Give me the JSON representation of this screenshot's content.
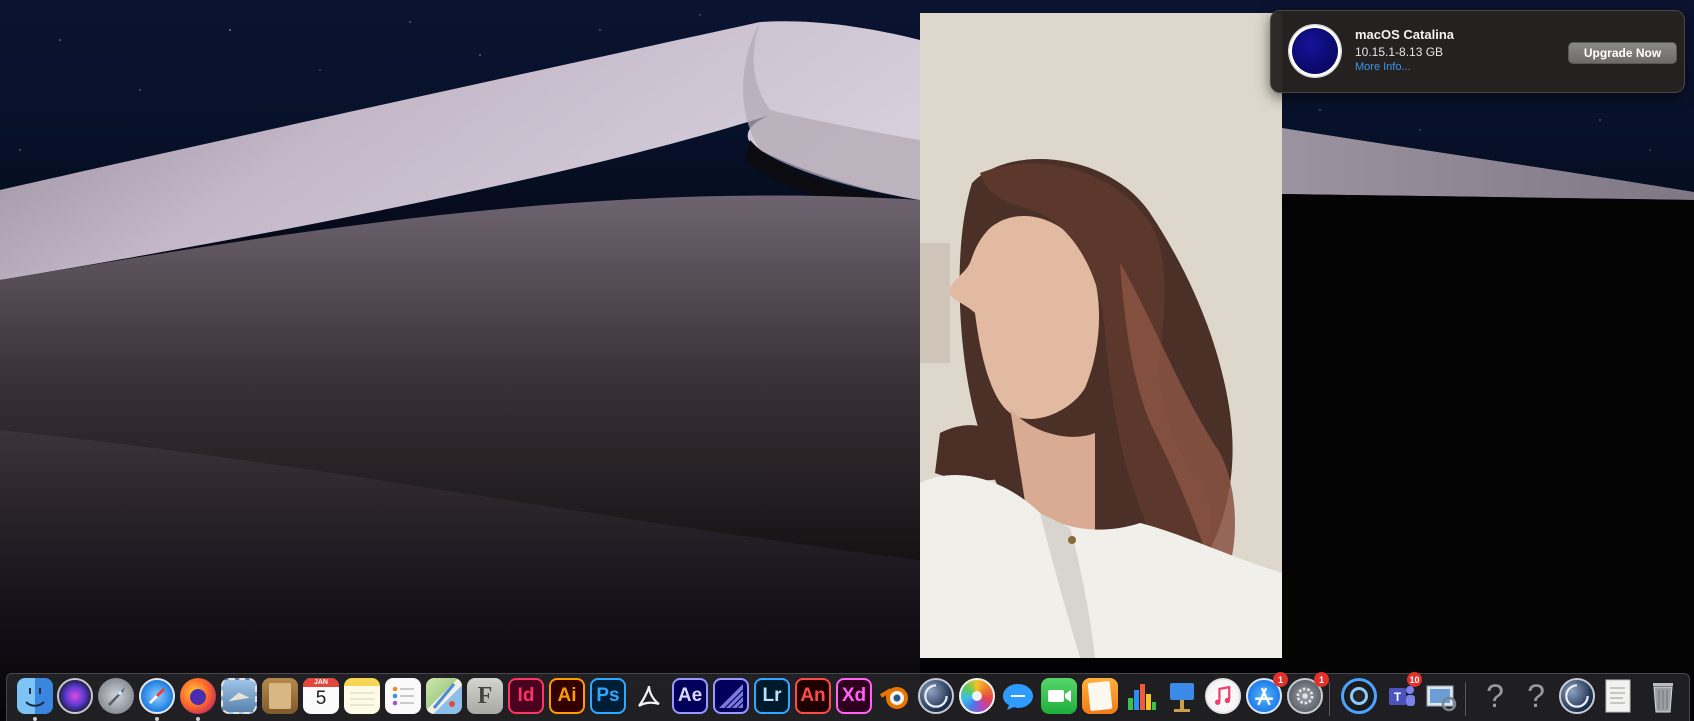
{
  "notification": {
    "title": "macOS Catalina",
    "subtitle": "10.15.1-8.13 GB",
    "link": "More Info...",
    "button": "Upgrade Now",
    "icon": "catalina-icon"
  },
  "dock": {
    "apps": [
      {
        "name": "Finder",
        "icon": "finder-icon"
      },
      {
        "name": "Siri",
        "icon": "siri-icon"
      },
      {
        "name": "Launchpad",
        "icon": "rocket-icon"
      },
      {
        "name": "Safari",
        "icon": "compass-icon"
      },
      {
        "name": "Firefox",
        "icon": "firefox-icon"
      },
      {
        "name": "Mail",
        "icon": "stamp-icon"
      },
      {
        "name": "Contacts",
        "icon": "address-book-icon"
      },
      {
        "name": "Calendar",
        "icon": "calendar-icon",
        "month": "JAN",
        "day": "5"
      },
      {
        "name": "Notes",
        "icon": "notes-icon"
      },
      {
        "name": "Reminders",
        "icon": "checklist-icon"
      },
      {
        "name": "Maps",
        "icon": "map-icon"
      },
      {
        "name": "Font Book",
        "icon": "font-icon",
        "label": "F"
      },
      {
        "name": "InDesign",
        "icon": "indesign-icon",
        "label": "Id"
      },
      {
        "name": "Illustrator",
        "icon": "illustrator-icon",
        "label": "Ai"
      },
      {
        "name": "Photoshop",
        "icon": "photoshop-icon",
        "label": "Ps"
      },
      {
        "name": "Acrobat",
        "icon": "acrobat-icon"
      },
      {
        "name": "After Effects",
        "icon": "aftereffects-icon",
        "label": "Ae"
      },
      {
        "name": "Media Encoder",
        "icon": "media-encoder-icon"
      },
      {
        "name": "Lightroom",
        "icon": "lightroom-icon",
        "label": "Lr"
      },
      {
        "name": "Animate",
        "icon": "animate-icon",
        "label": "An"
      },
      {
        "name": "XD",
        "icon": "xd-icon",
        "label": "Xd"
      },
      {
        "name": "Blender",
        "icon": "blender-icon"
      },
      {
        "name": "Cinema 4D",
        "icon": "cinema4d-icon"
      },
      {
        "name": "Photos",
        "icon": "photos-icon"
      },
      {
        "name": "Messages",
        "icon": "messages-icon"
      },
      {
        "name": "FaceTime",
        "icon": "facetime-icon"
      },
      {
        "name": "Pages",
        "icon": "pages-icon"
      },
      {
        "name": "Numbers",
        "icon": "numbers-icon"
      },
      {
        "name": "Keynote",
        "icon": "keynote-icon"
      },
      {
        "name": "Music",
        "icon": "music-icon"
      },
      {
        "name": "App Store",
        "icon": "app-store-icon",
        "badge": "1"
      },
      {
        "name": "System Preferences",
        "icon": "gear-icon",
        "badge": "1"
      },
      {
        "name": "Screen Recording",
        "icon": "screen-record-icon"
      },
      {
        "name": "Teams",
        "icon": "teams-icon",
        "badge": "10"
      },
      {
        "name": "Preview",
        "icon": "preview-icon"
      },
      {
        "name": "Unknown App",
        "icon": "question-icon",
        "label": "?"
      },
      {
        "name": "Unknown App",
        "icon": "question-icon",
        "label": "?"
      },
      {
        "name": "Cinema 4D",
        "icon": "cinema4d-icon"
      },
      {
        "name": "Document",
        "icon": "document-icon"
      },
      {
        "name": "Trash",
        "icon": "trash-icon"
      }
    ]
  },
  "colors": {
    "notification_bg": "#26221f",
    "link": "#3a95e8",
    "badge": "#e2302b",
    "catalina_blue": "#0b0a6e"
  }
}
